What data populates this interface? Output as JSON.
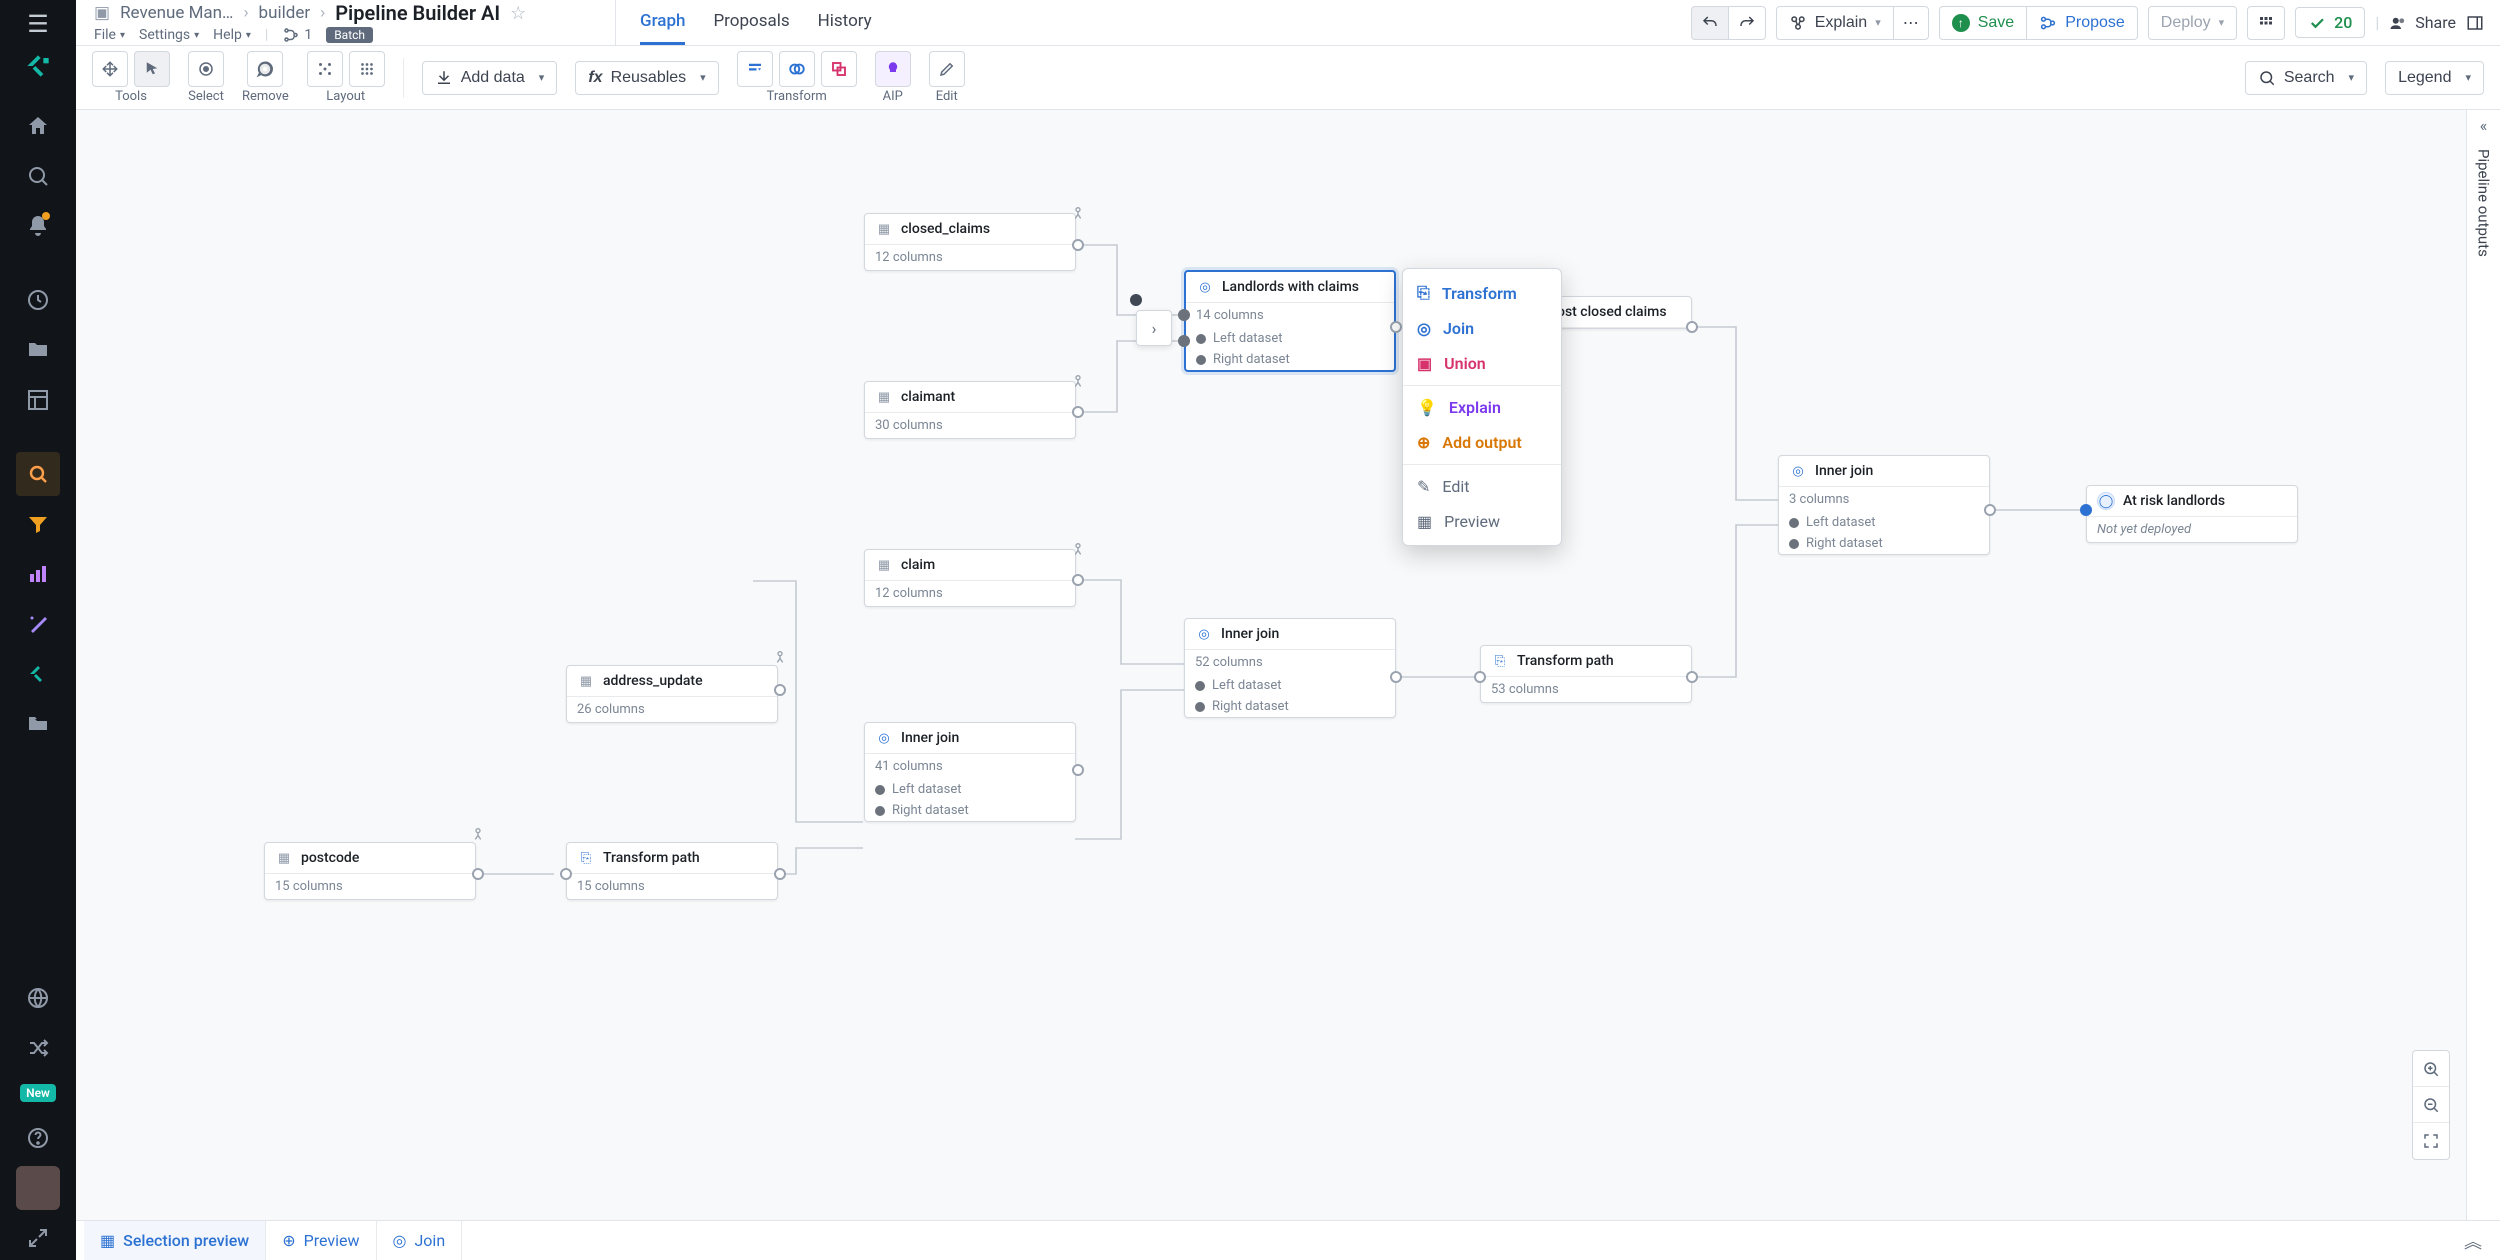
{
  "breadcrumb": {
    "root": "Revenue Man…",
    "mid": "builder",
    "title": "Pipeline Builder AI"
  },
  "menus": {
    "file": "File",
    "settings": "Settings",
    "help": "Help",
    "count": "1",
    "batch": "Batch"
  },
  "tabs": {
    "graph": "Graph",
    "proposals": "Proposals",
    "history": "History"
  },
  "top_actions": {
    "explain": "Explain",
    "save": "Save",
    "propose": "Propose",
    "deploy": "Deploy",
    "warnings": "20",
    "share": "Share"
  },
  "toolbar": {
    "tools": "Tools",
    "select": "Select",
    "remove": "Remove",
    "layout": "Layout",
    "add_data": "Add data",
    "reusables": "Reusables",
    "transform": "Transform",
    "aip": "AIP",
    "edit": "Edit",
    "search": "Search",
    "legend": "Legend"
  },
  "right_panel": {
    "label": "Pipeline outputs"
  },
  "context_menu": {
    "transform": "Transform",
    "join": "Join",
    "union": "Union",
    "explain": "Explain",
    "add_output": "Add output",
    "edit": "Edit",
    "preview": "Preview"
  },
  "bottom": {
    "selection_preview": "Selection preview",
    "preview": "Preview",
    "join": "Join"
  },
  "nodes": {
    "closed_claims": {
      "title": "closed_claims",
      "meta": "12 columns"
    },
    "claimant": {
      "title": "claimant",
      "meta": "30 columns"
    },
    "claim": {
      "title": "claim",
      "meta": "12 columns"
    },
    "address_update": {
      "title": "address_update",
      "meta": "26 columns"
    },
    "postcode": {
      "title": "postcode",
      "meta": "15 columns"
    },
    "transform_path_1": {
      "title": "Transform path",
      "meta": "15 columns"
    },
    "inner_join_1": {
      "title": "Inner join",
      "meta": "41 columns",
      "left": "Left dataset",
      "right": "Right dataset"
    },
    "landlords": {
      "title": "Landlords with claims",
      "meta": "14 columns",
      "left": "Left dataset",
      "right": "Right dataset"
    },
    "high_cost": {
      "title": "High cost closed claims"
    },
    "inner_join_2": {
      "title": "Inner join",
      "meta": "52 columns",
      "left": "Left dataset",
      "right": "Right dataset"
    },
    "transform_path_2": {
      "title": "Transform path",
      "meta": "53 columns"
    },
    "inner_join_3": {
      "title": "Inner join",
      "meta": "3 columns",
      "left": "Left dataset",
      "right": "Right dataset"
    },
    "at_risk": {
      "title": "At risk landlords",
      "meta": "Not yet deployed"
    }
  }
}
